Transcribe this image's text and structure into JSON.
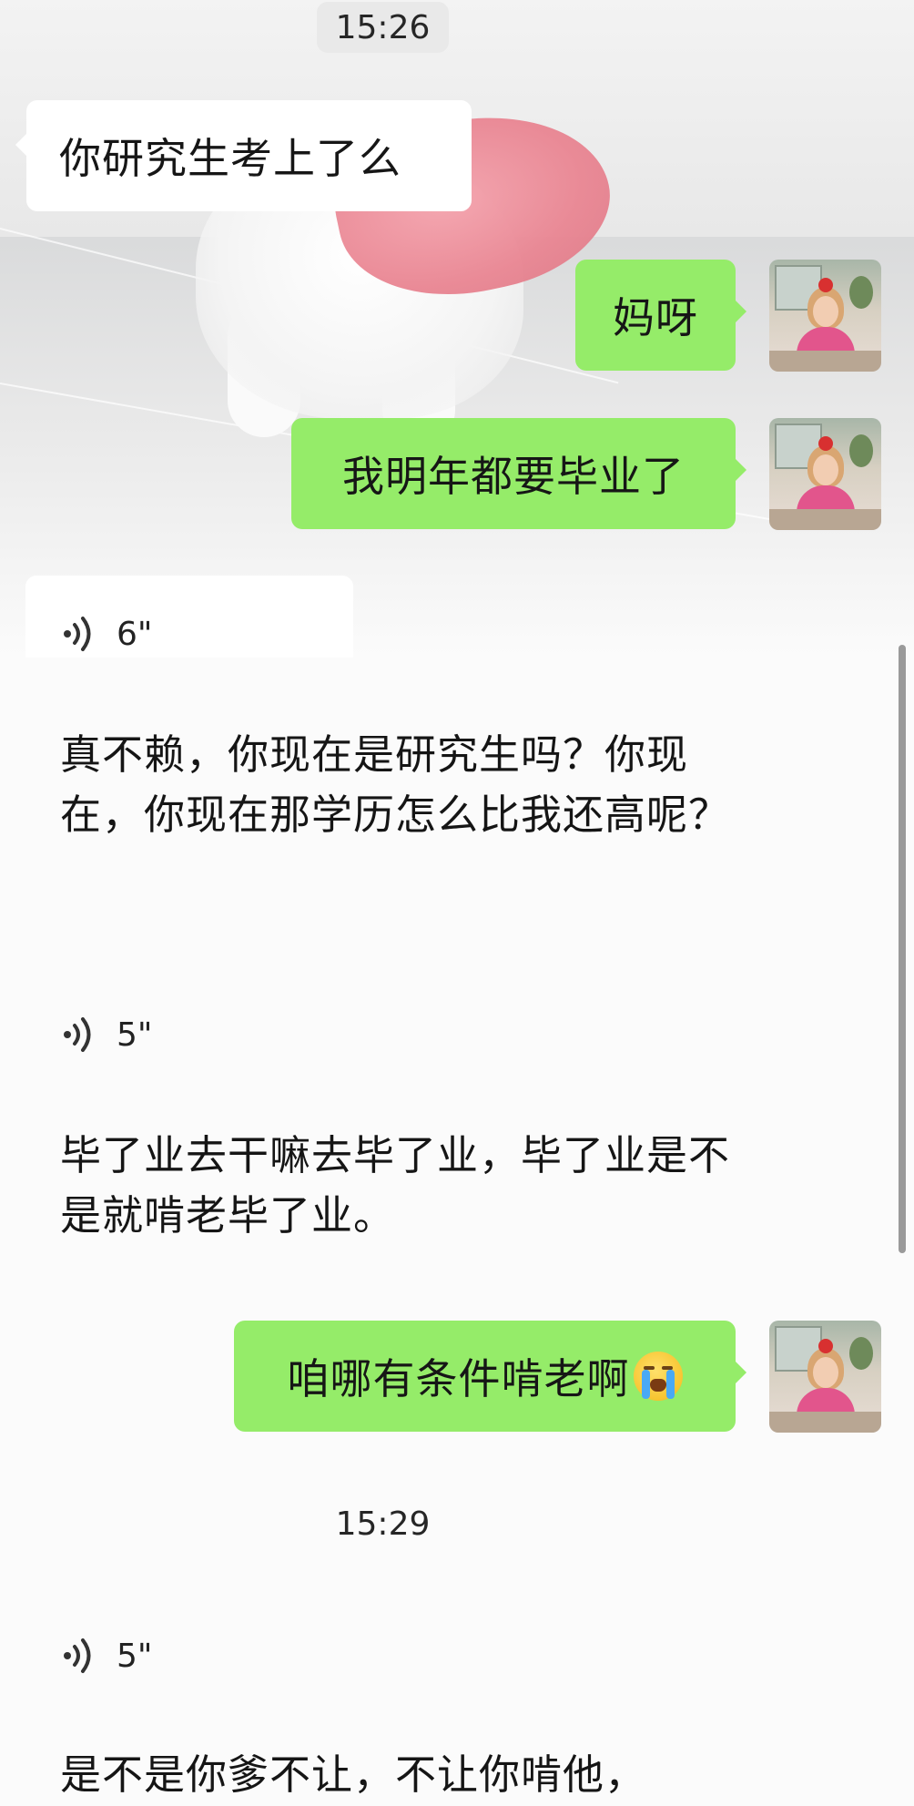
{
  "timestamps": [
    "15:26",
    "15:29"
  ],
  "messages": {
    "in_1": "你研究生考上了么",
    "out_1": "妈呀",
    "out_2": "我明年都要毕业了",
    "out_3": "咱哪有条件啃老啊"
  },
  "voice": [
    {
      "duration": "6\"",
      "transcript": "真不赖，你现在是研究生吗？你现在，你现在那学历怎么比我还高呢？"
    },
    {
      "duration": "5\"",
      "transcript": "毕了业去干嘛去毕了业，毕了业是不是就啃老毕了业。"
    },
    {
      "duration": "5\"",
      "transcript": "是不是你爹不让，不让你啃他，"
    }
  ],
  "emoji": {
    "out_3": "crying-face"
  },
  "colors": {
    "outgoing_bubble": "#95ec69",
    "incoming_bubble": "#ffffff",
    "chat_background": "#fbfbfb"
  },
  "background_image": "white-dog-with-pink-toy"
}
